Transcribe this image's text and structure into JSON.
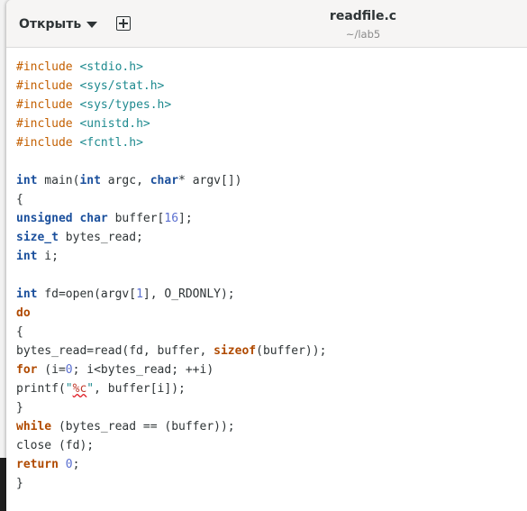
{
  "header": {
    "open_label": "Открыть",
    "title": "readfile.c",
    "subtitle": "~/lab5"
  },
  "icons": {
    "open_menu": "chevron-down-icon",
    "new_tab": "plus-square-icon"
  },
  "colors": {
    "preprocessor": "#c35f00",
    "include_path": "#1e8a8f",
    "type_keyword": "#1a4f9c",
    "control_keyword": "#b04a00",
    "number": "#5a6fd0",
    "plain": "#2e3436"
  },
  "code_lines": [
    [
      [
        "pre",
        "#include"
      ],
      [
        "plain",
        " "
      ],
      [
        "inc",
        "<stdio.h>"
      ]
    ],
    [
      [
        "pre",
        "#include"
      ],
      [
        "plain",
        " "
      ],
      [
        "inc",
        "<sys/stat.h>"
      ]
    ],
    [
      [
        "pre",
        "#include"
      ],
      [
        "plain",
        " "
      ],
      [
        "inc",
        "<sys/types.h>"
      ]
    ],
    [
      [
        "pre",
        "#include"
      ],
      [
        "plain",
        " "
      ],
      [
        "inc",
        "<unistd.h>"
      ]
    ],
    [
      [
        "pre",
        "#include"
      ],
      [
        "plain",
        " "
      ],
      [
        "inc",
        "<fcntl.h>"
      ]
    ],
    [],
    [
      [
        "type",
        "int"
      ],
      [
        "plain",
        " main("
      ],
      [
        "type",
        "int"
      ],
      [
        "plain",
        " argc, "
      ],
      [
        "type",
        "char"
      ],
      [
        "plain",
        "* argv[])"
      ]
    ],
    [
      [
        "plain",
        "{"
      ]
    ],
    [
      [
        "type",
        "unsigned"
      ],
      [
        "plain",
        " "
      ],
      [
        "type",
        "char"
      ],
      [
        "plain",
        " buffer["
      ],
      [
        "num",
        "16"
      ],
      [
        "plain",
        "];"
      ]
    ],
    [
      [
        "type",
        "size_t"
      ],
      [
        "plain",
        " bytes_read;"
      ]
    ],
    [
      [
        "type",
        "int"
      ],
      [
        "plain",
        " i;"
      ]
    ],
    [],
    [
      [
        "type",
        "int"
      ],
      [
        "plain",
        " fd=open(argv["
      ],
      [
        "num",
        "1"
      ],
      [
        "plain",
        "], O_RDONLY);"
      ]
    ],
    [
      [
        "kw",
        "do"
      ]
    ],
    [
      [
        "plain",
        "{"
      ]
    ],
    [
      [
        "plain",
        "bytes_read=read(fd, buffer, "
      ],
      [
        "kw",
        "sizeof"
      ],
      [
        "plain",
        "(buffer));"
      ]
    ],
    [
      [
        "kw",
        "for"
      ],
      [
        "plain",
        " (i="
      ],
      [
        "num",
        "0"
      ],
      [
        "plain",
        "; i<bytes_read; ++i)"
      ]
    ],
    [
      [
        "plain",
        "printf("
      ],
      [
        "str",
        "\""
      ],
      [
        "fmt",
        "%c"
      ],
      [
        "str",
        "\""
      ],
      [
        "plain",
        ", buffer[i]);"
      ]
    ],
    [
      [
        "plain",
        "}"
      ]
    ],
    [
      [
        "kw",
        "while"
      ],
      [
        "plain",
        " (bytes_read == (buffer));"
      ]
    ],
    [
      [
        "plain",
        "close (fd);"
      ]
    ],
    [
      [
        "kw",
        "return"
      ],
      [
        "plain",
        " "
      ],
      [
        "num",
        "0"
      ],
      [
        "plain",
        ";"
      ]
    ],
    [
      [
        "plain",
        "}"
      ]
    ]
  ]
}
